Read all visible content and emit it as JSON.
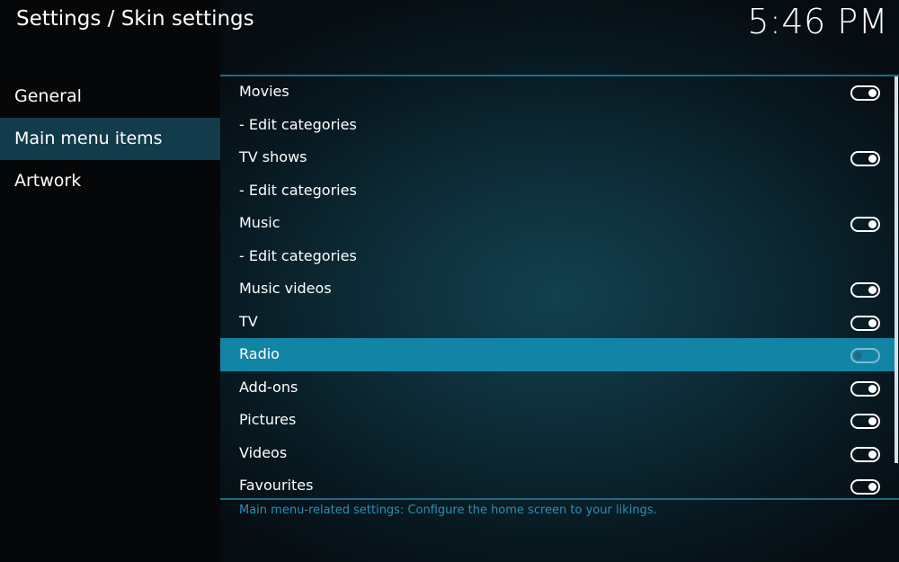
{
  "header": {
    "title": "Settings / Skin settings",
    "clock": "5:46 PM"
  },
  "sidebar": {
    "items": [
      {
        "label": "General"
      },
      {
        "label": "Main menu items"
      },
      {
        "label": "Artwork"
      }
    ]
  },
  "settings": {
    "items": [
      {
        "label": "Movies",
        "toggle": "on"
      },
      {
        "label": "- Edit categories"
      },
      {
        "label": "TV shows",
        "toggle": "on"
      },
      {
        "label": "- Edit categories"
      },
      {
        "label": "Music",
        "toggle": "on"
      },
      {
        "label": "- Edit categories"
      },
      {
        "label": "Music videos",
        "toggle": "on"
      },
      {
        "label": "TV",
        "toggle": "on"
      },
      {
        "label": "Radio",
        "toggle": "off"
      },
      {
        "label": "Add-ons",
        "toggle": "on"
      },
      {
        "label": "Pictures",
        "toggle": "on"
      },
      {
        "label": "Videos",
        "toggle": "on"
      },
      {
        "label": "Favourites",
        "toggle": "on"
      }
    ]
  },
  "footer": {
    "description": "Main menu-related settings: Configure the home screen to your likings."
  },
  "colors": {
    "sidebar_selected": "#123c4b",
    "row_focused": "#1285a7",
    "divider": "#1a6d86",
    "description_text": "#2a8fb5"
  }
}
